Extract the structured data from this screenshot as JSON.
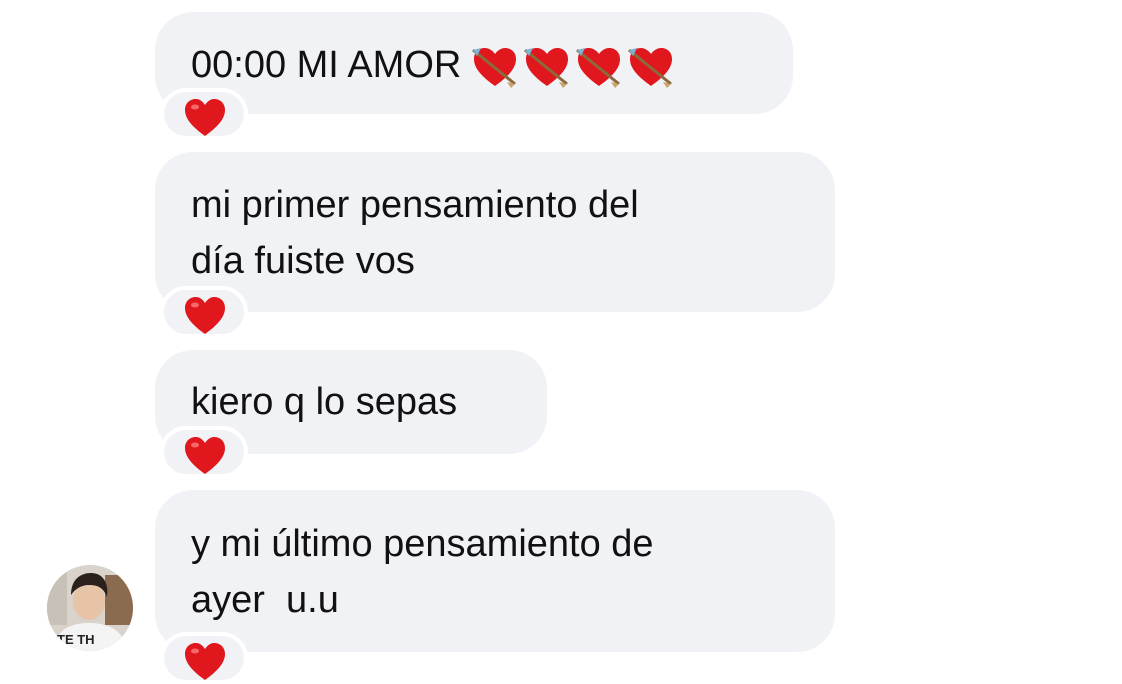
{
  "messages": [
    {
      "text": "00:00  MI AMOR",
      "emoji": [
        "heart-with-arrow",
        "heart-with-arrow",
        "heart-with-arrow",
        "heart-with-arrow"
      ],
      "reaction": "red-heart"
    },
    {
      "text": "mi primer pensamiento del\ndía fuiste vos",
      "reaction": "red-heart"
    },
    {
      "text": "kiero q lo sepas",
      "reaction": "red-heart"
    },
    {
      "text": "y mi último pensamiento de\nayer  u.u",
      "reaction": "red-heart"
    }
  ],
  "avatar": {
    "shirt_text": "TE TH"
  },
  "colors": {
    "bubble": "#f1f2f6",
    "heart": "#e0181d",
    "text": "#111111"
  }
}
